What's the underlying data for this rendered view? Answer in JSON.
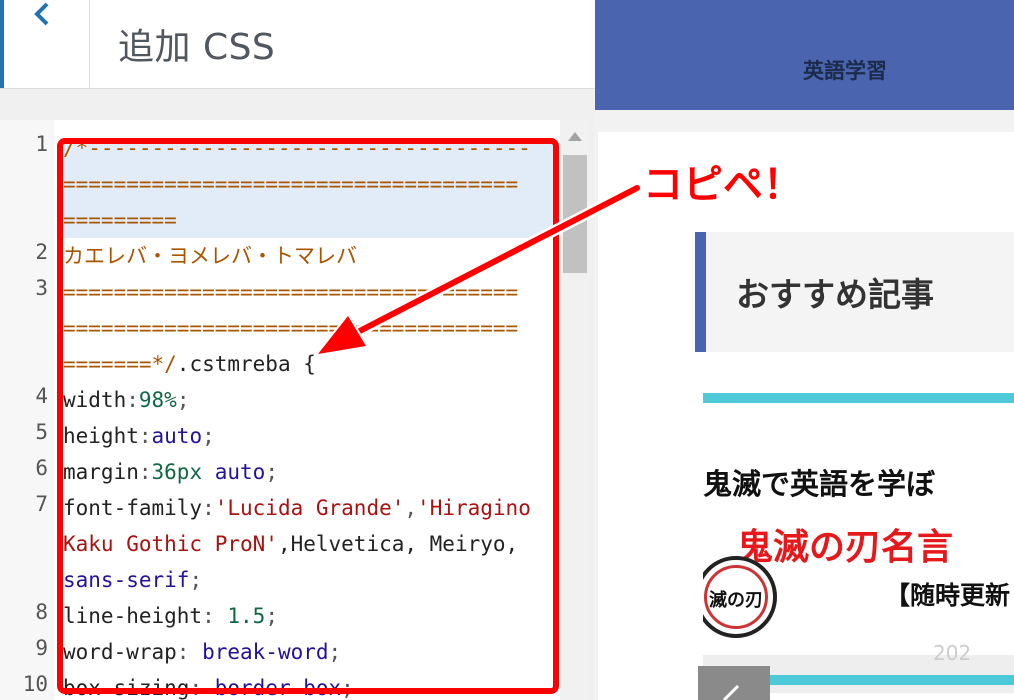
{
  "panel": {
    "title": "追加 CSS",
    "back_label": "<"
  },
  "editor": {
    "line_numbers": [
      "1",
      "2",
      "3",
      "4",
      "5",
      "6",
      "7",
      "8",
      "9",
      "10"
    ],
    "lines": [
      {
        "no": "1",
        "text": "/*-----------------------------------"
      },
      {
        "text": "===================================="
      },
      {
        "text": "========="
      },
      {
        "no": "2",
        "text": "カエレバ・ヨメレバ・トマレバ"
      },
      {
        "no": "3",
        "text": "===================================="
      },
      {
        "text": "===================================="
      },
      {
        "text": "=======*/",
        "rest": ".cstmreba {"
      },
      {
        "no": "4",
        "prop": "width",
        "val": "98%"
      },
      {
        "no": "5",
        "prop": "height",
        "val": "auto"
      },
      {
        "no": "6",
        "prop": "margin",
        "val": "36px",
        "val2": "auto"
      },
      {
        "no": "7",
        "prop": "font-family",
        "val": "'Lucida Grande'",
        "val2": "'Hiragino"
      },
      {
        "text": "Kaku Gothic ProN'",
        "rest": ",Helvetica, Meiryo,"
      },
      {
        "text": "sans-serif"
      },
      {
        "no": "8",
        "prop": "line-height",
        "val": "1.5"
      },
      {
        "no": "9",
        "prop": "word-wrap",
        "val": "break-word"
      },
      {
        "no": "10",
        "prop": "box-sizing",
        "val": "border-box"
      }
    ]
  },
  "annotation": {
    "text": "コピペ！",
    "color": "#ff0000"
  },
  "preview": {
    "site_title": "英語学習",
    "section_title": "おすすめ記事",
    "article": {
      "headline": "鬼滅で英語を学ぼ",
      "red_title": "鬼滅の刃名言",
      "subtitle": "【随時更新",
      "logo_text": "滅の刃",
      "date": "202"
    },
    "accent_color": "#4a64b0"
  }
}
